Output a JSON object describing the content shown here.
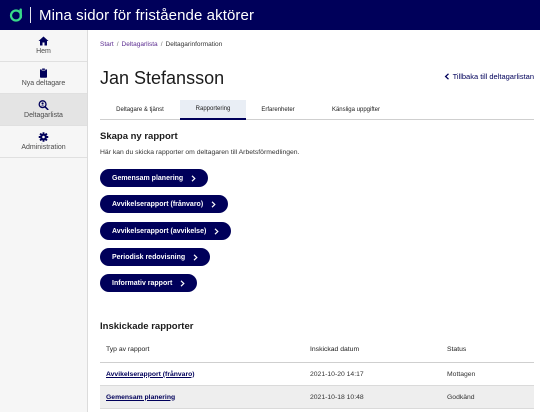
{
  "header": {
    "title": "Mina sidor för fristående aktörer",
    "logo": "af-logo"
  },
  "sidebar": {
    "items": [
      {
        "label": "Hem",
        "icon": "home-icon"
      },
      {
        "label": "Nya deltagare",
        "icon": "clipboard-icon"
      },
      {
        "label": "Deltagarlista",
        "icon": "search-person-icon",
        "active": true
      },
      {
        "label": "Administration",
        "icon": "gear-icon"
      }
    ]
  },
  "breadcrumb": {
    "items": [
      "Start",
      "Deltagarlista",
      "Deltagarinformation"
    ],
    "separator": "/"
  },
  "page": {
    "title": "Jan Stefansson",
    "back_link": "Tillbaka till deltagarlistan"
  },
  "tabs": [
    {
      "label": "Deltagare & tjänst"
    },
    {
      "label": "Rapportering",
      "active": true
    },
    {
      "label": "Erfarenheter"
    },
    {
      "label": "Känsliga uppgifter"
    }
  ],
  "create_report": {
    "title": "Skapa ny rapport",
    "description": "Här kan du skicka rapporter om deltagaren till Arbetsförmedlingen.",
    "buttons": [
      {
        "label": "Gemensam planering"
      },
      {
        "label": "Avvikelserapport (frånvaro)"
      },
      {
        "label": "Avvikelserapport (avvikelse)"
      },
      {
        "label": "Periodisk redovisning"
      },
      {
        "label": "Informativ rapport"
      }
    ]
  },
  "submitted": {
    "title": "Inskickade rapporter",
    "columns": [
      "Typ av rapport",
      "Inskickad datum",
      "Status"
    ],
    "rows": [
      {
        "type": "Avvikelserapport (frånvaro)",
        "date": "2021-10-20 14:17",
        "status": "Mottagen"
      },
      {
        "type": "Gemensam planering",
        "date": "2021-10-18 10:48",
        "status": "Godkänd"
      }
    ]
  },
  "colors": {
    "brand": "#00005a",
    "sidebar_bg": "#f6f6f6",
    "active_tab_bg": "#e9eef5",
    "alt_row": "#eeeeee"
  }
}
